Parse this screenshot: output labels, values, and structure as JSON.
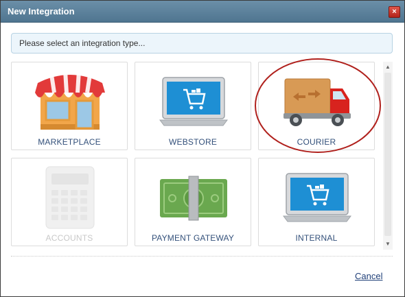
{
  "dialog": {
    "title": "New Integration",
    "close_icon": "close-icon",
    "hint": "Please select an integration type...",
    "cancel_label": "Cancel"
  },
  "tiles": [
    {
      "label": "MARKETPLACE",
      "icon": "marketplace-store-icon",
      "enabled": true
    },
    {
      "label": "WEBSTORE",
      "icon": "laptop-cart-icon",
      "enabled": true
    },
    {
      "label": "COURIER",
      "icon": "delivery-truck-icon",
      "enabled": true,
      "highlighted": true
    },
    {
      "label": "ACCOUNTS",
      "icon": "calculator-icon",
      "enabled": false
    },
    {
      "label": "PAYMENT GATEWAY",
      "icon": "banknote-icon",
      "enabled": true
    },
    {
      "label": "INTERNAL",
      "icon": "laptop-cart-icon",
      "enabled": true
    }
  ],
  "colors": {
    "titlebar": "#5a7f99",
    "label": "#33507a",
    "highlight_ring": "#b0201c"
  }
}
